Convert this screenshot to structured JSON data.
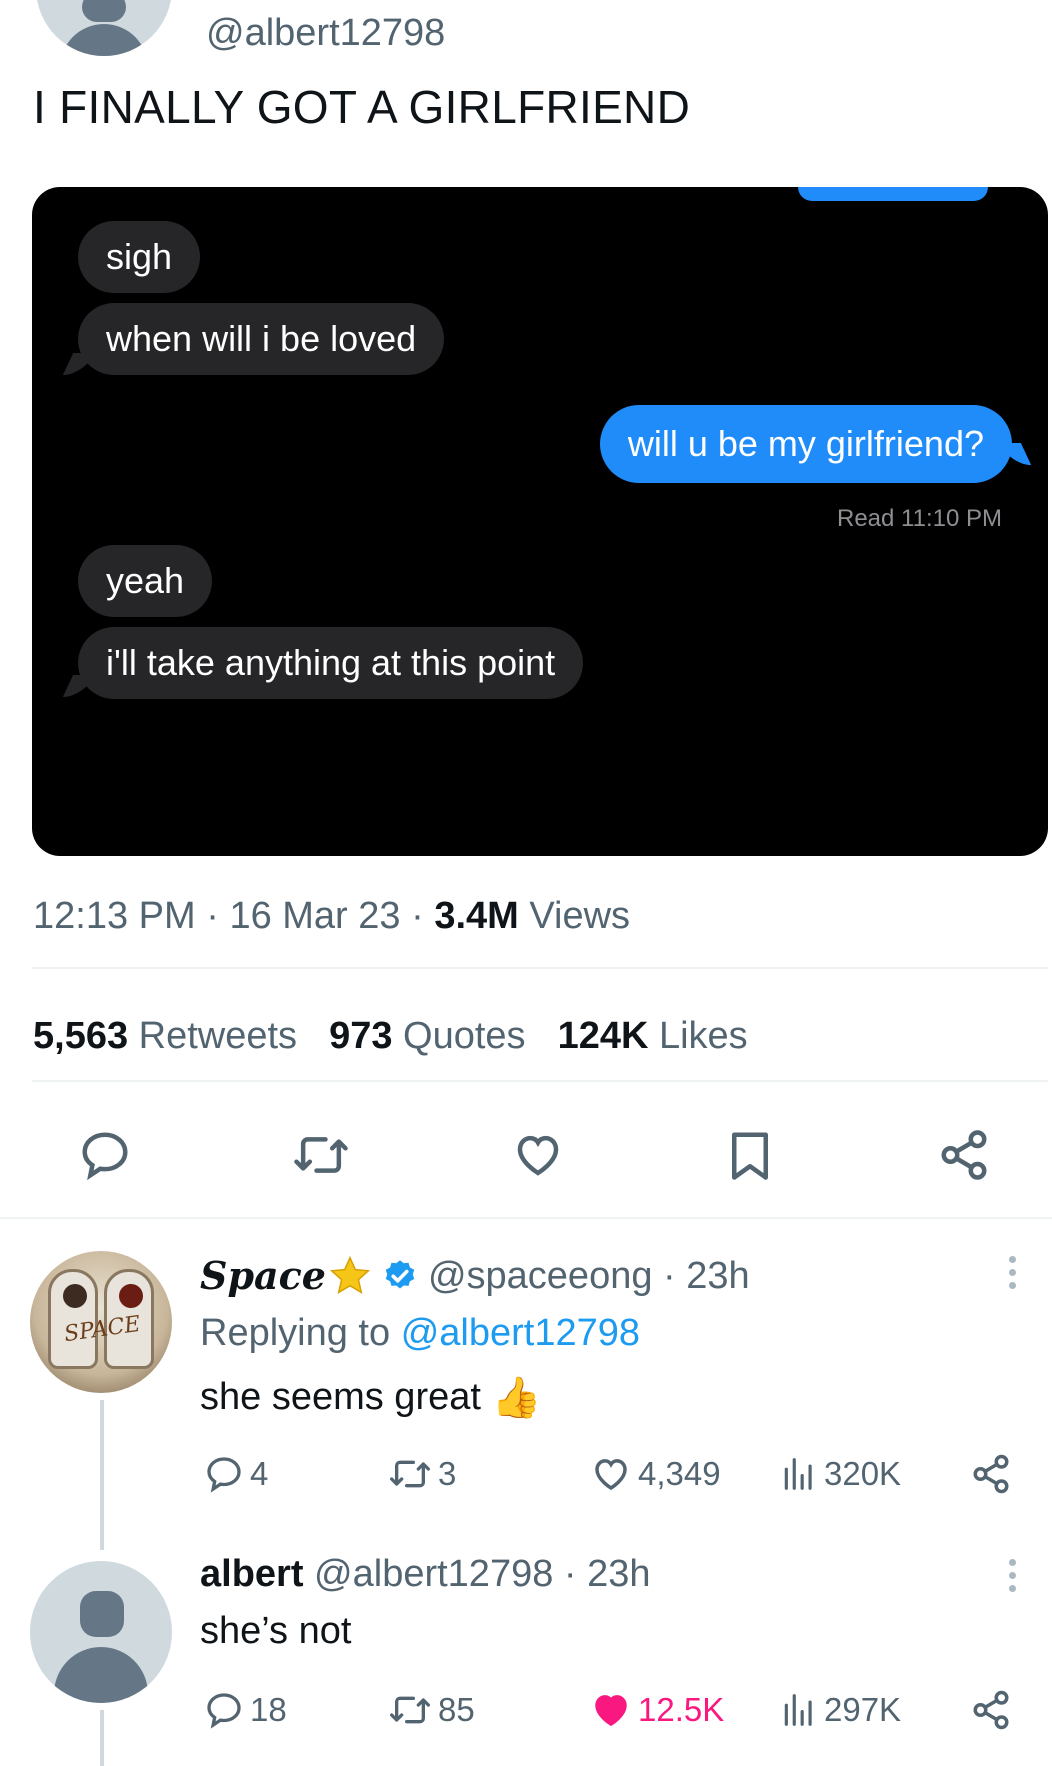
{
  "main_tweet": {
    "handle": "@albert12798",
    "text": "I FINALLY GOT A GIRLFRIEND",
    "chat": {
      "messages": [
        {
          "side": "in",
          "text": "sigh"
        },
        {
          "side": "in",
          "text": "when will i be loved"
        },
        {
          "side": "out",
          "text": "will u be my girlfriend?"
        },
        {
          "side": "in",
          "text": "yeah"
        },
        {
          "side": "in",
          "text": "i'll take anything at this point"
        }
      ],
      "read_receipt": "Read 11:10 PM"
    },
    "time": "12:13 PM",
    "date": "16 Mar 23",
    "views_count": "3.4M",
    "views_label": "Views",
    "stats": {
      "retweets_count": "5,563",
      "retweets_label": "Retweets",
      "quotes_count": "973",
      "quotes_label": "Quotes",
      "likes_count": "124K",
      "likes_label": "Likes"
    }
  },
  "replies": [
    {
      "name": "Space",
      "handle": "@spaceeong",
      "time": "23h",
      "replying_prefix": "Replying to",
      "replying_to": "@albert12798",
      "text": "she seems great",
      "emoji": "👍",
      "counts": {
        "replies": "4",
        "retweets": "3",
        "likes": "4,349",
        "views": "320K"
      },
      "liked": false
    },
    {
      "name": "albert",
      "handle": "@albert12798",
      "time": "23h",
      "text": "she’s not",
      "counts": {
        "replies": "18",
        "retweets": "85",
        "likes": "12.5K",
        "views": "297K"
      },
      "liked": true
    }
  ],
  "colors": {
    "link": "#1d9bf0",
    "like": "#f91880",
    "imessage_blue": "#1f8cf9",
    "verified": "#1d9bf0",
    "star": "#f5c518"
  },
  "icons": [
    "reply-icon",
    "retweet-icon",
    "like-icon",
    "bookmark-icon",
    "share-icon",
    "views-icon",
    "verified-icon",
    "star-icon",
    "more-icon"
  ]
}
